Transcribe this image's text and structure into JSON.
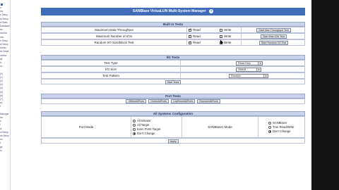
{
  "page_title": "SANBlaze VirtuaLUN Multi-System Manager",
  "sidebar": {
    "items": [
      "s",
      "ms",
      "e Setup",
      "al Setup",
      "el Stats",
      "Database",
      "tor",
      "nection",
      "Info",
      "n Setup",
      "st Setup",
      "Admin",
      "sk Detail",
      "vertise",
      "ail",
      "ix",
      "ox",
      "",
      "(0)",
      "(1)",
      "(2)",
      "(3)",
      "(4)",
      "(5)",
      "(6)",
      "(7)",
      "es",
      "t",
      "",
      "Manager",
      "ion",
      "s",
      "l",
      "ts",
      "ld Setup",
      "de Setup",
      "rm",
      "t",
      "ge",
      "rs"
    ]
  },
  "built_in_tests": {
    "header": "Built In Tests",
    "rows": [
      {
        "label": "Maximum Data Throughput",
        "read_label": "Read",
        "read_checked": true,
        "write_label": "Write",
        "write_checked": false,
        "button": "Start Max Throughput Test"
      },
      {
        "label": "Maximum Number of I/Os",
        "read_label": "Read",
        "read_checked": true,
        "write_label": "Write",
        "write_checked": false,
        "button": "Start Max I/O# Test"
      },
      {
        "label": "Random I/O Size/Block Test",
        "read_label": "Read",
        "read_checked": true,
        "write_label": "Write",
        "write_checked": true,
        "button": "Start Random I/O Test"
      }
    ]
  },
  "io_tests": {
    "header": "I/O Tests",
    "rows": [
      {
        "label": "Test Type",
        "value": "Read Only"
      },
      {
        "label": "I/O Size",
        "value": "256KB"
      },
      {
        "label": "Test Pattern",
        "value": "Random"
      }
    ],
    "start_button": "Start Tests"
  },
  "port_tests": {
    "header": "Port Tests",
    "buttons": [
      "OfflineAllPorts",
      "OnlineAllPorts",
      "LinkResetAllPorts",
      "ReprobeAllPorts"
    ]
  },
  "all_systems": {
    "header": "All Systems Configuration",
    "port_mode_label": "Port Mode",
    "port_mode_options": [
      {
        "label": "All Initiator",
        "selected": false
      },
      {
        "label": "All Target",
        "selected": false
      },
      {
        "label": "Even Ports Target",
        "selected": false
      },
      {
        "label": "Don't Change",
        "selected": true
      }
    ],
    "sanblazer_label": "SANBlazer Mode",
    "sanblazer_options": [
      {
        "label": "SANBlazer",
        "selected": false
      },
      {
        "label": "True Read/Write",
        "selected": false
      },
      {
        "label": "Don't Change",
        "selected": true
      }
    ],
    "apply_button": "Apply"
  }
}
